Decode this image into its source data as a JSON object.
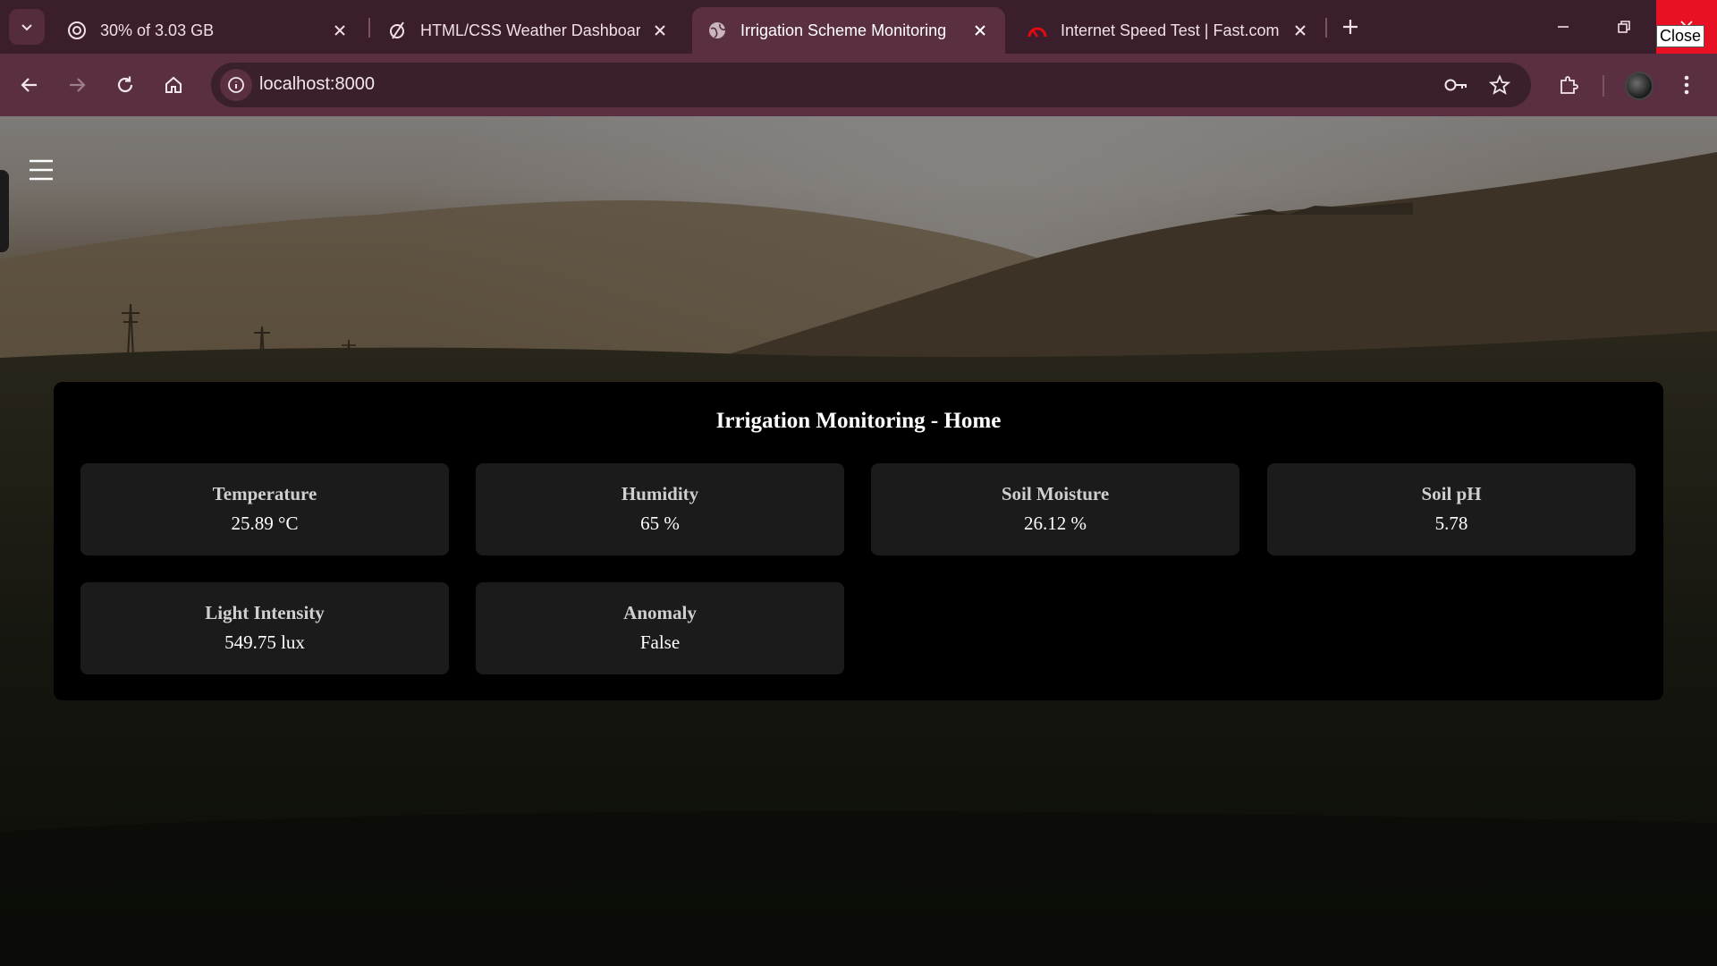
{
  "browser": {
    "tabs": [
      {
        "title": "30% of 3.03 GB",
        "icon": "openai-icon",
        "active": false
      },
      {
        "title": "HTML/CSS Weather Dashboard",
        "icon": "slash-circle-icon",
        "active": false
      },
      {
        "title": "Irrigation Scheme Monitoring",
        "icon": "globe-icon",
        "active": true
      },
      {
        "title": "Internet Speed Test | Fast.com",
        "icon": "speedometer-icon",
        "active": false
      }
    ],
    "url": "localhost:8000",
    "close_tooltip": "Close",
    "accent": "#5a2f41",
    "tabstrip_color": "#3b1e2b",
    "close_color": "#e81123"
  },
  "page": {
    "title": "Irrigation Monitoring - Home",
    "panel_color": "#000000",
    "card_color": "#1b1b1b",
    "cards": [
      {
        "label": "Temperature",
        "value": "25.89 °C"
      },
      {
        "label": "Humidity",
        "value": "65 %"
      },
      {
        "label": "Soil Moisture",
        "value": "26.12 %"
      },
      {
        "label": "Soil pH",
        "value": "5.78"
      },
      {
        "label": "Light Intensity",
        "value": "549.75 lux"
      },
      {
        "label": "Anomaly",
        "value": "False"
      }
    ]
  }
}
